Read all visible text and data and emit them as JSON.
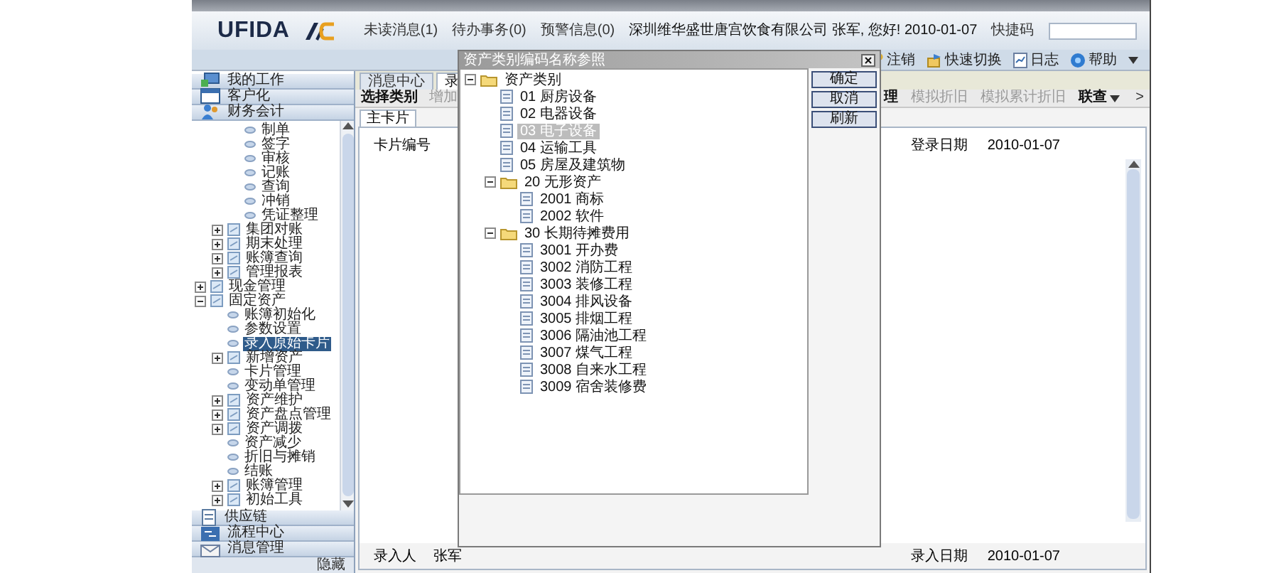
{
  "header": {
    "logo": "UFIDA",
    "links": [
      "未读消息(1)",
      "待办事务(0)",
      "预警信息(0)"
    ],
    "user_info": "深圳维华盛世唐宫饮食有限公司 张军, 您好! 2010-01-07",
    "quick_code_label": "快捷码"
  },
  "toolbar": [
    {
      "label": "注销",
      "kind": "key"
    },
    {
      "label": "快速切换",
      "kind": "switch"
    },
    {
      "label": "日志",
      "kind": "log"
    },
    {
      "label": "帮助",
      "kind": "help"
    }
  ],
  "nav": {
    "top_sections": [
      {
        "label": "我的工作",
        "kind": "work"
      },
      {
        "label": "客户化",
        "kind": "custom"
      },
      {
        "label": "财务会计",
        "kind": "people"
      }
    ],
    "tree": [
      {
        "children": [
          {
            "children": [
              {
                "label": "制单",
                "kind": "leaf",
                "selected": false
              },
              {
                "label": "签字",
                "kind": "leaf",
                "selected": false
              },
              {
                "label": "审核",
                "kind": "leaf",
                "selected": false
              },
              {
                "label": "记账",
                "kind": "leaf",
                "selected": false
              },
              {
                "label": "查询",
                "kind": "leaf",
                "selected": false
              },
              {
                "label": "冲销",
                "kind": "leaf",
                "selected": false
              },
              {
                "label": "凭证整理",
                "kind": "leaf",
                "selected": false
              }
            ]
          },
          {
            "label": "集团对账",
            "kind": "folder",
            "expanded": false,
            "selected": false
          },
          {
            "label": "期末处理",
            "kind": "folder",
            "expanded": false,
            "selected": false
          },
          {
            "label": "账簿查询",
            "kind": "folder",
            "expanded": false,
            "selected": false
          },
          {
            "label": "管理报表",
            "kind": "folder",
            "expanded": false,
            "selected": false
          }
        ]
      },
      {
        "label": "现金管理",
        "kind": "folder",
        "expanded": false,
        "selected": false
      },
      {
        "label": "固定资产",
        "kind": "folder",
        "expanded": true,
        "selected": false,
        "children": [
          {
            "label": "账簿初始化",
            "kind": "leaf",
            "selected": false
          },
          {
            "label": "参数设置",
            "kind": "leaf",
            "selected": false
          },
          {
            "label": "录入原始卡片",
            "kind": "leaf",
            "selected": true
          },
          {
            "label": "新增资产",
            "kind": "folder",
            "expanded": false,
            "selected": false
          },
          {
            "label": "卡片管理",
            "kind": "leaf",
            "selected": false
          },
          {
            "label": "变动单管理",
            "kind": "leaf",
            "selected": false
          },
          {
            "label": "资产维护",
            "kind": "folder",
            "expanded": false,
            "selected": false
          },
          {
            "label": "资产盘点管理",
            "kind": "folder",
            "expanded": false,
            "selected": false
          },
          {
            "label": "资产调拨",
            "kind": "folder",
            "expanded": false,
            "selected": false
          },
          {
            "label": "资产减少",
            "kind": "leaf",
            "selected": false
          },
          {
            "label": "折旧与摊销",
            "kind": "leaf",
            "selected": false
          },
          {
            "label": "结账",
            "kind": "leaf",
            "selected": false
          },
          {
            "label": "账簿管理",
            "kind": "folder",
            "expanded": false,
            "selected": false
          },
          {
            "label": "初始工具",
            "kind": "folder",
            "expanded": false,
            "selected": false
          }
        ]
      }
    ],
    "bottom_sections": [
      {
        "label": "供应链",
        "kind": "supply"
      },
      {
        "label": "流程中心",
        "kind": "flow"
      },
      {
        "label": "消息管理",
        "kind": "mail"
      }
    ],
    "hide_label": "隐藏"
  },
  "main": {
    "tabs": [
      {
        "label": "消息中心",
        "selected": false
      },
      {
        "label": "录",
        "selected": true
      }
    ],
    "actions_left": [
      {
        "label": "选择类别",
        "disabled": false,
        "dropdown": false
      },
      {
        "label": "增加",
        "disabled": true,
        "dropdown": false
      }
    ],
    "actions_right": [
      {
        "label": "理",
        "disabled": false,
        "dropdown": false
      },
      {
        "label": "模拟折旧",
        "disabled": true,
        "dropdown": false
      },
      {
        "label": "模拟累计折旧",
        "disabled": true,
        "dropdown": false
      },
      {
        "label": "联查",
        "disabled": false,
        "dropdown": true
      }
    ],
    "more": ">",
    "card_tabs": [
      {
        "label": "主卡片",
        "selected": true
      }
    ],
    "fields": {
      "card_no_label": "卡片编号",
      "login_date_label": "登录日期",
      "login_date": "2010-01-07",
      "entered_by_label": "录入人",
      "entered_by": "张军",
      "entry_date_label": "录入日期",
      "entry_date": "2010-01-07"
    }
  },
  "dialog": {
    "title": "资产类别编码名称参照",
    "tree": [
      {
        "label": "资产类别",
        "kind": "folder",
        "expanded": true,
        "selected": false,
        "children": [
          {
            "label": "01 厨房设备",
            "kind": "leaf",
            "selected": false
          },
          {
            "label": "02 电器设备",
            "kind": "leaf",
            "selected": false
          },
          {
            "label": "03 电子设备",
            "kind": "leaf",
            "selected": true
          },
          {
            "label": "04 运输工具",
            "kind": "leaf",
            "selected": false
          },
          {
            "label": "05 房屋及建筑物",
            "kind": "leaf",
            "selected": false
          },
          {
            "label": "20 无形资产",
            "kind": "folder",
            "expanded": true,
            "selected": false,
            "children": [
              {
                "label": "2001 商标",
                "kind": "leaf",
                "selected": false
              },
              {
                "label": "2002 软件",
                "kind": "leaf",
                "selected": false
              }
            ]
          },
          {
            "label": "30 长期待摊费用",
            "kind": "folder",
            "expanded": true,
            "selected": false,
            "children": [
              {
                "label": "3001 开办费",
                "kind": "leaf",
                "selected": false
              },
              {
                "label": "3002 消防工程",
                "kind": "leaf",
                "selected": false
              },
              {
                "label": "3003 装修工程",
                "kind": "leaf",
                "selected": false
              },
              {
                "label": "3004 排风设备",
                "kind": "leaf",
                "selected": false
              },
              {
                "label": "3005 排烟工程",
                "kind": "leaf",
                "selected": false
              },
              {
                "label": "3006 隔油池工程",
                "kind": "leaf",
                "selected": false
              },
              {
                "label": "3007 煤气工程",
                "kind": "leaf",
                "selected": false
              },
              {
                "label": "3008 自来水工程",
                "kind": "leaf",
                "selected": false
              },
              {
                "label": "3009 宿舍装修费",
                "kind": "leaf",
                "selected": false
              }
            ]
          }
        ]
      }
    ],
    "buttons": [
      "确定",
      "取消",
      "刷新"
    ]
  }
}
